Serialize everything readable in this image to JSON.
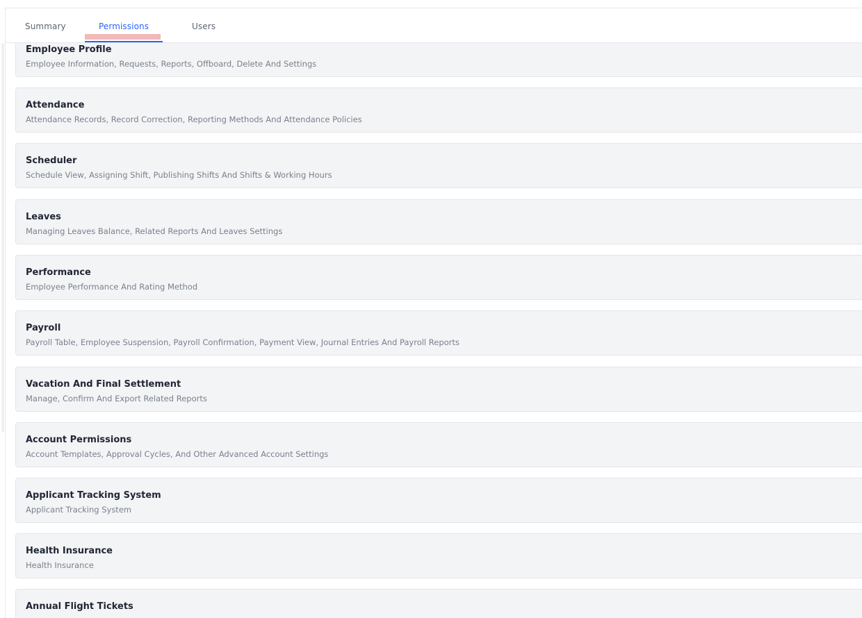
{
  "tabs": {
    "summary": "Summary",
    "permissions": "Permissions",
    "users": "Users",
    "active": "Permissions"
  },
  "colors": {
    "accent": "#2764ff",
    "card_background": "#f3f4f6",
    "title_text": "#1f2533",
    "description_text": "#7a808b",
    "highlight": "#f3b8b8"
  },
  "permissions": [
    {
      "title": "Employee Profile",
      "description": "Employee Information, Requests, Reports, Offboard, Delete And Settings"
    },
    {
      "title": "Attendance",
      "description": "Attendance Records, Record Correction, Reporting Methods And Attendance Policies"
    },
    {
      "title": "Scheduler",
      "description": "Schedule View, Assigning Shift, Publishing Shifts And Shifts & Working Hours"
    },
    {
      "title": "Leaves",
      "description": "Managing Leaves Balance, Related Reports And Leaves Settings"
    },
    {
      "title": "Performance",
      "description": "Employee Performance And Rating Method"
    },
    {
      "title": "Payroll",
      "description": "Payroll Table, Employee Suspension, Payroll Confirmation, Payment View, Journal Entries And Payroll Reports"
    },
    {
      "title": "Vacation And Final Settlement",
      "description": "Manage, Confirm And Export Related Reports"
    },
    {
      "title": "Account Permissions",
      "description": "Account Templates, Approval Cycles, And Other Advanced Account Settings"
    },
    {
      "title": "Applicant Tracking System",
      "description": "Applicant Tracking System"
    },
    {
      "title": "Health Insurance",
      "description": "Health Insurance"
    },
    {
      "title": "Annual Flight Tickets",
      "description": ""
    }
  ]
}
